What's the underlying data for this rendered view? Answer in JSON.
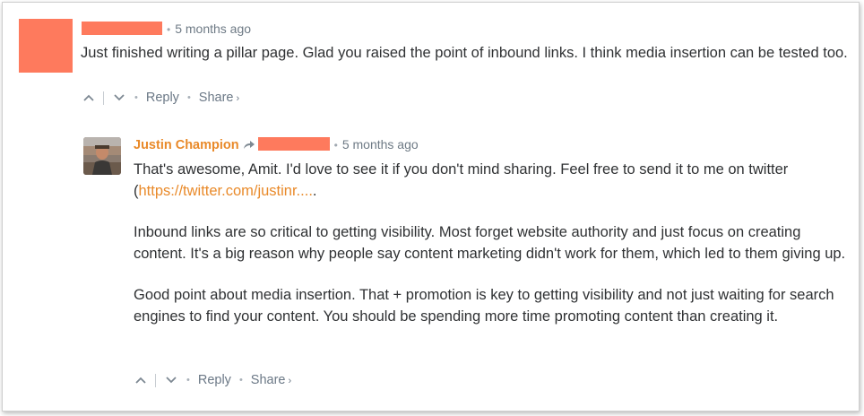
{
  "colors": {
    "redaction": "#fe7a5d",
    "author": "#e98a2a",
    "link": "#e98a2a",
    "meta": "#6e7a85",
    "body": "#2f3133"
  },
  "comment": {
    "timestamp": "5 months ago",
    "text": "Just finished writing a pillar page. Glad you raised the point of inbound links. I think media insertion can be tested too.",
    "actions": {
      "upvote_icon": "chevron-up-icon",
      "downvote_icon": "chevron-down-icon",
      "reply": "Reply",
      "share": "Share",
      "share_chevron": "›"
    }
  },
  "reply": {
    "author": "Justin Champion",
    "reply_to_icon": "reply-arrow-icon",
    "timestamp": "5 months ago",
    "paragraph1_text": "That's awesome, Amit. I'd love to see it if you don't mind sharing. Feel free to send it to me on twitter (",
    "paragraph1_link": "https://twitter.com/justinr....",
    "paragraph1_after": ".",
    "paragraph2": "Inbound links are so critical to getting visibility. Most forget website authority and just focus on creating content. It's a big reason why people say content marketing didn't work for them, which led to them giving up.",
    "paragraph3": "Good point about media insertion. That + promotion is key to getting visibility and not just waiting for search engines to find your content. You should be spending more time promoting content than creating it.",
    "actions": {
      "upvote_icon": "chevron-up-icon",
      "downvote_icon": "chevron-down-icon",
      "reply": "Reply",
      "share": "Share",
      "share_chevron": "›"
    }
  }
}
